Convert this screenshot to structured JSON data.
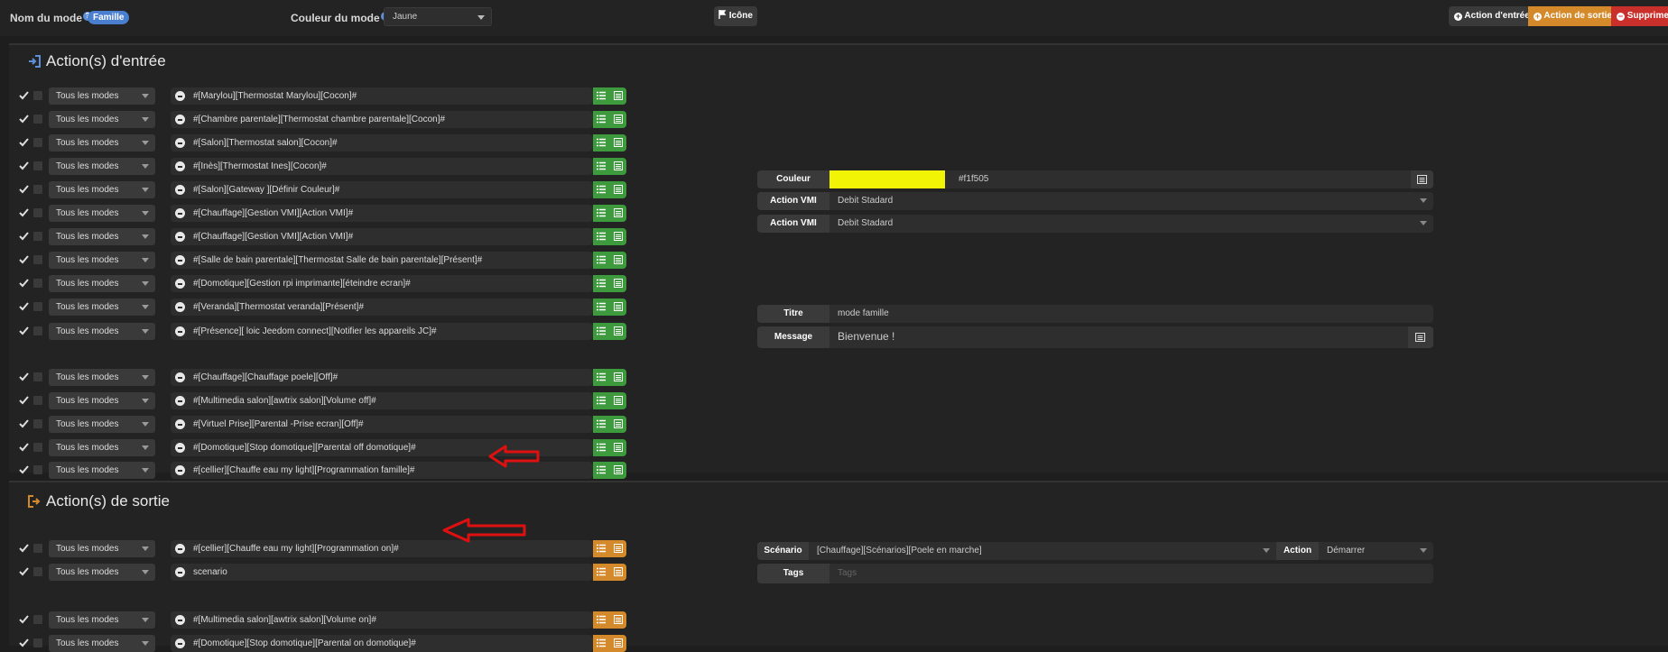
{
  "header": {
    "mode_name_label": "Nom du mode",
    "mode_name_help": "?",
    "mode_name_value": "Famille",
    "mode_color_label": "Couleur du mode",
    "mode_color_help": "?",
    "mode_color_value": "Jaune",
    "icon_button": "Icône",
    "add_entry_button": "Action d'entrée",
    "add_exit_button": "Action de sortie",
    "delete_button": "Supprimer"
  },
  "colors": {
    "entry_green": "#3d9a3d",
    "exit_orange": "#d4892a",
    "delete_red": "#c9302c",
    "color_swatch": "#f1f505",
    "arrow_red": "#e01010"
  },
  "entry": {
    "title": "Action(s) d'entrée",
    "rows": [
      {
        "mode": "Tous les modes",
        "cmd": "#[Marylou][Thermostat Marylou][Cocon]#"
      },
      {
        "mode": "Tous les modes",
        "cmd": "#[Chambre parentale][Thermostat chambre parentale][Cocon]#"
      },
      {
        "mode": "Tous les modes",
        "cmd": "#[Salon][Thermostat salon][Cocon]#"
      },
      {
        "mode": "Tous les modes",
        "cmd": "#[Inès][Thermostat Ines][Cocon]#"
      },
      {
        "mode": "Tous les modes",
        "cmd": "#[Salon][Gateway ][Définir Couleur]#"
      },
      {
        "mode": "Tous les modes",
        "cmd": "#[Chauffage][Gestion VMI][Action VMI]#"
      },
      {
        "mode": "Tous les modes",
        "cmd": "#[Chauffage][Gestion VMI][Action VMI]#"
      },
      {
        "mode": "Tous les modes",
        "cmd": "#[Salle de bain parentale][Thermostat Salle de bain parentale][Présent]#"
      },
      {
        "mode": "Tous les modes",
        "cmd": "#[Domotique][Gestion rpi imprimante][éteindre ecran]#"
      },
      {
        "mode": "Tous les modes",
        "cmd": "#[Veranda][Thermostat veranda][Présent]#"
      },
      {
        "mode": "Tous les modes",
        "cmd": "#[Présence][ loic Jeedom connect][Notifier les appareils JC]#"
      },
      {
        "mode": "Tous les modes",
        "cmd": "#[Chauffage][Chauffage poele][Off]#"
      },
      {
        "mode": "Tous les modes",
        "cmd": "#[Multimedia salon][awtrix salon][Volume off]#"
      },
      {
        "mode": "Tous les modes",
        "cmd": "#[Virtuel Prise][Parental -Prise ecran][Off]#"
      },
      {
        "mode": "Tous les modes",
        "cmd": "#[Domotique][Stop domotique][Parental off domotique]#"
      },
      {
        "mode": "Tous les modes",
        "cmd": "#[cellier][Chauffe eau my light][Programmation famille]#"
      }
    ],
    "color_opt": {
      "label": "Couleur",
      "value": "#f1f505"
    },
    "vmi_opts": [
      {
        "label": "Action VMI",
        "value": "Debit Stadard"
      },
      {
        "label": "Action VMI",
        "value": "Debit Stadard"
      }
    ],
    "notify": {
      "title_label": "Titre",
      "title_value": "mode famille",
      "message_label": "Message",
      "message_value": "Bienvenue !"
    }
  },
  "exit": {
    "title": "Action(s) de sortie",
    "rows": [
      {
        "mode": "Tous les modes",
        "cmd": "#[cellier][Chauffe eau my light][Programmation on]#"
      },
      {
        "mode": "Tous les modes",
        "cmd": "scenario"
      },
      {
        "mode": "Tous les modes",
        "cmd": "#[Multimedia salon][awtrix salon][Volume on]#"
      },
      {
        "mode": "Tous les modes",
        "cmd": "#[Domotique][Stop domotique][Parental on domotique]#"
      }
    ],
    "scenario": {
      "label": "Scénario",
      "value": "[Chauffage][Scénarios][Poele en marche]",
      "action_label": "Action",
      "action_value": "Démarrer",
      "tags_label": "Tags",
      "tags_placeholder": "Tags"
    }
  }
}
